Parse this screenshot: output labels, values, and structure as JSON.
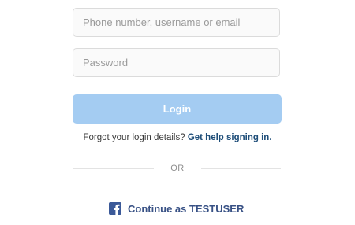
{
  "login_form": {
    "username_placeholder": "Phone number, username or email",
    "username_value": "",
    "password_placeholder": "Password",
    "password_value": "",
    "login_label": "Login"
  },
  "help": {
    "prompt": "Forgot your login details?",
    "link_label": "Get help signing in."
  },
  "divider": {
    "label": "OR"
  },
  "facebook": {
    "icon": "facebook-icon",
    "label": "Continue as TESTUSER"
  },
  "colors": {
    "login_button": "#a4ccf2",
    "facebook_brand": "#3b5998",
    "link": "#1f4e79"
  }
}
